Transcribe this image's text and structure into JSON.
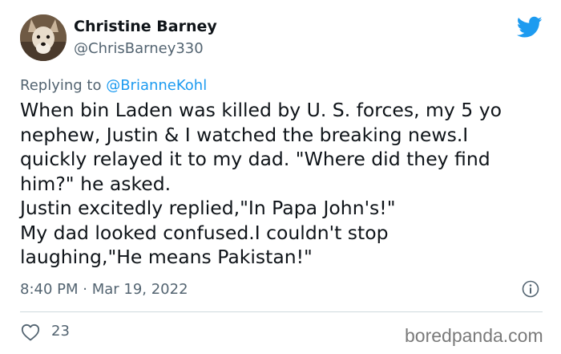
{
  "tweet": {
    "author_name": "Christine Barney",
    "author_handle": "@ChrisBarney330",
    "avatar_icon": "dog-avatar-icon",
    "platform_icon": "twitter-bird-icon",
    "reply_prefix": "Replying to ",
    "reply_to": "@BrianneKohl",
    "body_lines": [
      "When bin Laden was killed by U. S. forces, my 5 yo",
      "nephew, Justin & I watched the breaking news.I",
      "quickly relayed it to my dad. \"Where did they find",
      "him?\" he asked.",
      "Justin excitedly replied,\"In Papa John's!\"",
      "My dad looked confused.I couldn't stop",
      "laughing,\"He means Pakistan!\""
    ],
    "timestamp": "8:40 PM · Mar 19, 2022",
    "info_icon": "info-icon",
    "like_icon": "heart-icon",
    "like_count": "23"
  },
  "watermark": "boredpanda.com",
  "colors": {
    "text": "#0f1419",
    "secondary": "#536471",
    "accent": "#1d9bf0",
    "divider": "#cfd9de"
  }
}
